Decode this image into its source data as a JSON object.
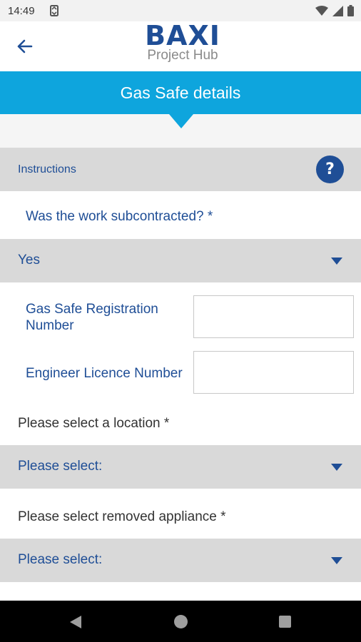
{
  "status_bar": {
    "time": "14:49",
    "icons": [
      "sync-icon",
      "wifi-icon",
      "signal-icon",
      "battery-icon"
    ]
  },
  "header": {
    "brand": "BAXI",
    "subtitle": "Project Hub",
    "back_icon": "arrow-left-icon"
  },
  "page": {
    "title": "Gas Safe details"
  },
  "instructions": {
    "label": "Instructions",
    "help_label": "?"
  },
  "subcontracted": {
    "question": "Was the work subcontracted? *",
    "value": "Yes"
  },
  "fields": {
    "gas_safe_label": "Gas Safe Registration Number",
    "gas_safe_value": "",
    "licence_label": "Engineer Licence Number",
    "licence_value": ""
  },
  "location": {
    "label": "Please select a location *",
    "value": "Please select:"
  },
  "removed_appliance": {
    "label": "Please select removed appliance *",
    "value": "Please select:"
  },
  "colors": {
    "brand_blue": "#1f4e96",
    "accent_cyan": "#0ea5dd",
    "band_grey": "#d9d9d9"
  },
  "nav": {
    "icons": [
      "nav-back-icon",
      "nav-home-icon",
      "nav-recents-icon"
    ]
  }
}
